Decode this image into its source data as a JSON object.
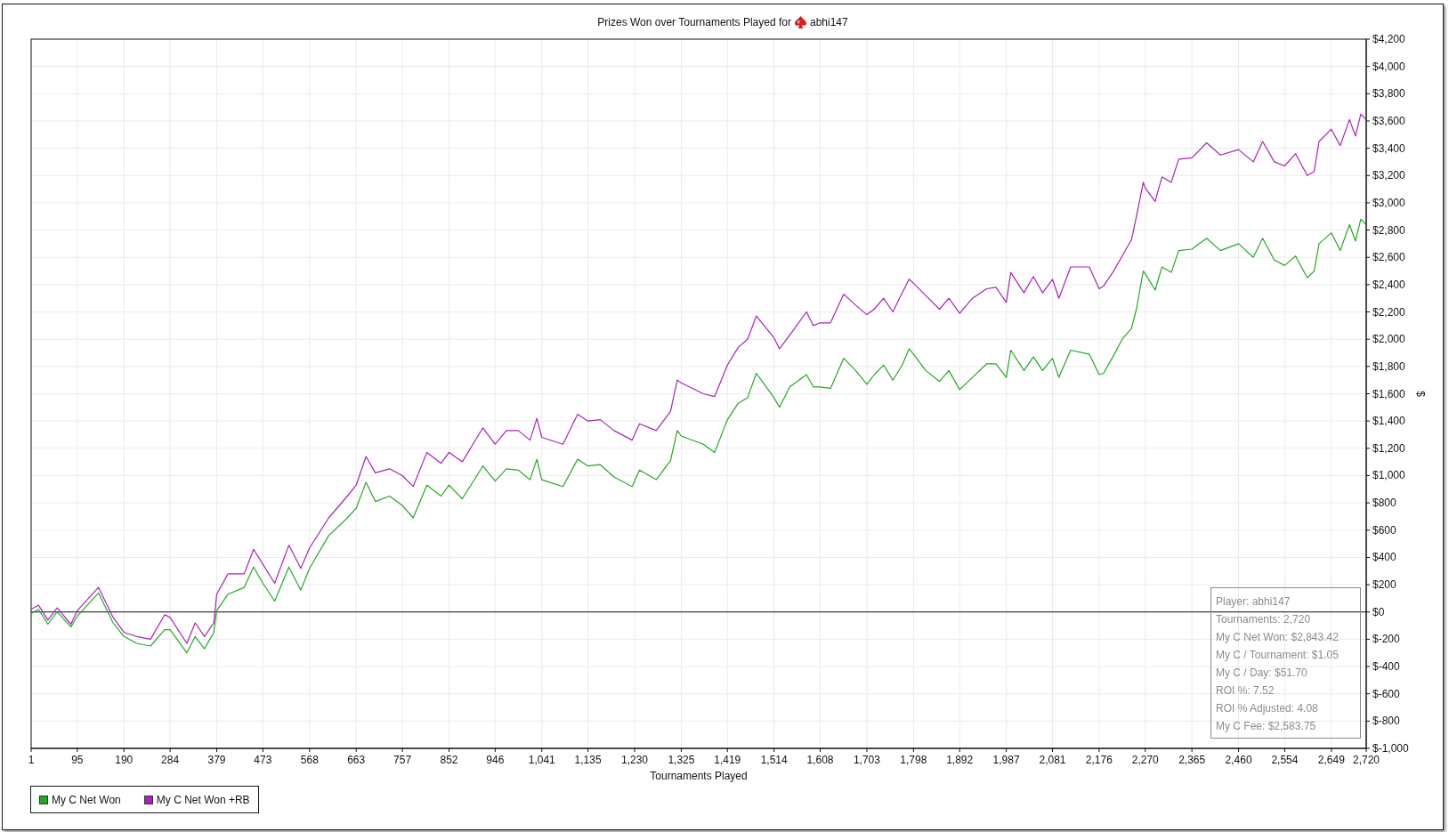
{
  "header": {
    "title": "Prizes Won over Tournaments Played for",
    "player": "abhi147"
  },
  "chart_data": {
    "type": "line",
    "grid": true,
    "xlabel": "Tournaments Played",
    "ylabel": "$",
    "xlim": [
      1,
      2720
    ],
    "ylim": [
      -1000,
      4200
    ],
    "xticks": [
      1,
      95,
      190,
      284,
      379,
      473,
      568,
      663,
      757,
      852,
      946,
      {
        "value": 1041,
        "label": "1,041"
      },
      {
        "value": 1135,
        "label": "1,135"
      },
      {
        "value": 1230,
        "label": "1,230"
      },
      {
        "value": 1325,
        "label": "1,325"
      },
      {
        "value": 1419,
        "label": "1,419"
      },
      {
        "value": 1514,
        "label": "1,514"
      },
      {
        "value": 1608,
        "label": "1,608"
      },
      {
        "value": 1703,
        "label": "1,703"
      },
      {
        "value": 1798,
        "label": "1,798"
      },
      {
        "value": 1892,
        "label": "1,892"
      },
      {
        "value": 1987,
        "label": "1,987"
      },
      {
        "value": 2081,
        "label": "2,081"
      },
      {
        "value": 2176,
        "label": "2,176"
      },
      {
        "value": 2270,
        "label": "2,270"
      },
      {
        "value": 2365,
        "label": "2,365"
      },
      {
        "value": 2460,
        "label": "2,460"
      },
      {
        "value": 2554,
        "label": "2,554"
      },
      {
        "value": 2649,
        "label": "2,649"
      },
      {
        "value": 2720,
        "label": "2,720"
      }
    ],
    "yticks": [
      {
        "value": 4200,
        "label": "$4,200"
      },
      {
        "value": 4000,
        "label": "$4,000"
      },
      {
        "value": 3800,
        "label": "$3,800"
      },
      {
        "value": 3600,
        "label": "$3,600"
      },
      {
        "value": 3400,
        "label": "$3,400"
      },
      {
        "value": 3200,
        "label": "$3,200"
      },
      {
        "value": 3000,
        "label": "$3,000"
      },
      {
        "value": 2800,
        "label": "$2,800"
      },
      {
        "value": 2600,
        "label": "$2,600"
      },
      {
        "value": 2400,
        "label": "$2,400"
      },
      {
        "value": 2200,
        "label": "$2,200"
      },
      {
        "value": 2000,
        "label": "$2,000"
      },
      {
        "value": 1800,
        "label": "$1,800"
      },
      {
        "value": 1600,
        "label": "$1,600"
      },
      {
        "value": 1400,
        "label": "$1,400"
      },
      {
        "value": 1200,
        "label": "$1,200"
      },
      {
        "value": 1000,
        "label": "$1,000"
      },
      {
        "value": 800,
        "label": "$800"
      },
      {
        "value": 600,
        "label": "$600"
      },
      {
        "value": 400,
        "label": "$400"
      },
      {
        "value": 200,
        "label": "$200"
      },
      {
        "value": 0,
        "label": "$0"
      },
      {
        "value": -200,
        "label": "$-200"
      },
      {
        "value": -400,
        "label": "$-400"
      },
      {
        "value": -600,
        "label": "$-600"
      },
      {
        "value": -800,
        "label": "$-800"
      },
      {
        "value": -1000,
        "label": "$-1,000"
      }
    ],
    "x": [
      1,
      16,
      35,
      54,
      82,
      95,
      138,
      168,
      190,
      216,
      244,
      273,
      284,
      318,
      335,
      354,
      373,
      379,
      402,
      435,
      454,
      473,
      497,
      526,
      550,
      568,
      607,
      645,
      663,
      683,
      702,
      731,
      757,
      779,
      807,
      836,
      852,
      879,
      921,
      946,
      969,
      993,
      1017,
      1031,
      1041,
      1084,
      1114,
      1135,
      1160,
      1188,
      1225,
      1240,
      1274,
      1303,
      1317,
      1325,
      1370,
      1393,
      1419,
      1441,
      1460,
      1478,
      1498,
      1514,
      1525,
      1546,
      1580,
      1594,
      1608,
      1629,
      1656,
      1680,
      1703,
      1718,
      1737,
      1756,
      1775,
      1789,
      1798,
      1823,
      1851,
      1870,
      1892,
      1918,
      1947,
      1966,
      1987,
      1996,
      2023,
      2042,
      2061,
      2081,
      2094,
      2118,
      2156,
      2176,
      2185,
      2204,
      2223,
      2242,
      2252,
      2266,
      2270,
      2290,
      2304,
      2323,
      2338,
      2365,
      2395,
      2423,
      2460,
      2490,
      2509,
      2533,
      2554,
      2576,
      2600,
      2614,
      2624,
      2649,
      2667,
      2686,
      2698,
      2709,
      2720
    ],
    "series": [
      {
        "name": "My C Net Won",
        "color": "#22aa22",
        "values": [
          -10,
          20,
          -90,
          0,
          -110,
          -30,
          140,
          -80,
          -180,
          -230,
          -250,
          -130,
          -130,
          -300,
          -180,
          -270,
          -150,
          10,
          130,
          180,
          330,
          210,
          80,
          330,
          160,
          320,
          560,
          690,
          760,
          950,
          810,
          850,
          780,
          690,
          930,
          850,
          930,
          830,
          1070,
          960,
          1050,
          1040,
          970,
          1120,
          970,
          920,
          1120,
          1070,
          1080,
          990,
          920,
          1040,
          970,
          1110,
          1330,
          1290,
          1230,
          1170,
          1410,
          1530,
          1570,
          1750,
          1650,
          1570,
          1500,
          1650,
          1740,
          1650,
          1650,
          1640,
          1860,
          1770,
          1670,
          1740,
          1810,
          1700,
          1810,
          1930,
          1890,
          1770,
          1690,
          1770,
          1630,
          1720,
          1820,
          1820,
          1720,
          1920,
          1770,
          1870,
          1770,
          1860,
          1720,
          1920,
          1890,
          1740,
          1750,
          1870,
          2000,
          2080,
          2220,
          2500,
          2480,
          2360,
          2530,
          2490,
          2650,
          2660,
          2740,
          2650,
          2700,
          2600,
          2740,
          2580,
          2540,
          2610,
          2450,
          2500,
          2700,
          2780,
          2650,
          2840,
          2720,
          2880,
          2840
        ]
      },
      {
        "name": "My C Net Won +RB",
        "color": "#aa22bb",
        "values": [
          20,
          50,
          -60,
          30,
          -90,
          10,
          180,
          -40,
          -150,
          -180,
          -200,
          -20,
          -40,
          -230,
          -80,
          -180,
          -80,
          130,
          280,
          280,
          460,
          350,
          210,
          490,
          320,
          470,
          690,
          850,
          930,
          1140,
          1020,
          1050,
          1000,
          920,
          1170,
          1090,
          1170,
          1100,
          1350,
          1230,
          1330,
          1330,
          1260,
          1420,
          1280,
          1230,
          1450,
          1400,
          1410,
          1330,
          1260,
          1380,
          1330,
          1470,
          1700,
          1680,
          1600,
          1580,
          1810,
          1940,
          2000,
          2170,
          2080,
          2010,
          1930,
          2030,
          2200,
          2100,
          2120,
          2120,
          2330,
          2250,
          2180,
          2220,
          2300,
          2200,
          2340,
          2440,
          2410,
          2320,
          2220,
          2300,
          2190,
          2300,
          2370,
          2380,
          2270,
          2490,
          2340,
          2460,
          2340,
          2440,
          2300,
          2530,
          2530,
          2370,
          2390,
          2490,
          2610,
          2730,
          2900,
          3150,
          3110,
          3010,
          3190,
          3150,
          3320,
          3330,
          3440,
          3350,
          3390,
          3300,
          3450,
          3300,
          3270,
          3360,
          3200,
          3230,
          3450,
          3540,
          3420,
          3610,
          3490,
          3650,
          3610
        ]
      }
    ]
  },
  "stats": [
    "Player: abhi147",
    "Tournaments: 2,720",
    "My C Net Won: $2,843.42",
    "My C / Tournament: $1.05",
    "My C / Day: $51.70",
    "ROI %: 7.52",
    "ROI % Adjusted: 4.08",
    "My C Fee: $2,583.75"
  ]
}
